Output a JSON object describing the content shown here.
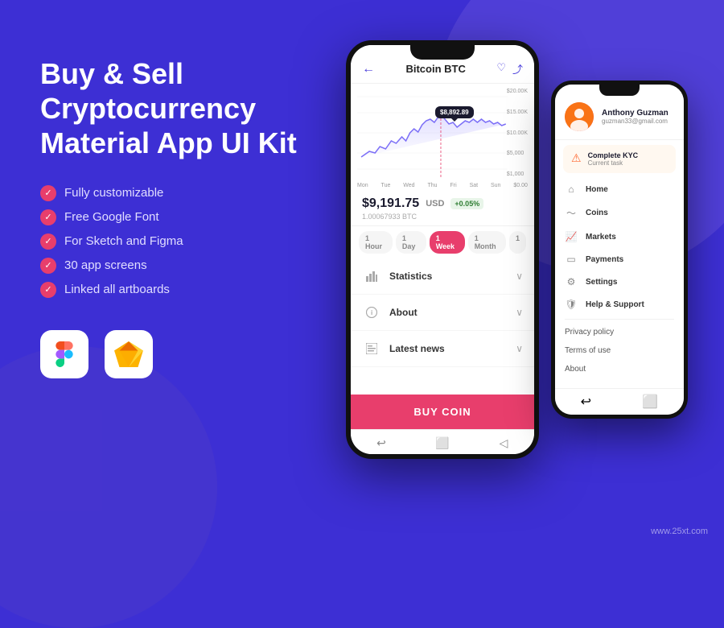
{
  "page": {
    "background": "#3d2fd4",
    "watermark": "www.25xt.com"
  },
  "left": {
    "title": "Buy & Sell\nCryptocurrency\nMaterial App UI Kit",
    "features": [
      "Fully customizable",
      "Free Google Font",
      "For Sketch and Figma",
      "30 app screens",
      "Linked all artboards"
    ],
    "tools": [
      {
        "name": "Figma",
        "icon": "🎨"
      },
      {
        "name": "Sketch",
        "icon": "💎"
      }
    ]
  },
  "main_phone": {
    "header": {
      "back": "←",
      "title": "Bitcoin BTC",
      "icon_heart": "♡",
      "icon_share": "⤴"
    },
    "chart": {
      "y_labels": [
        "$20.00K",
        "$15.00K",
        "$10.00K",
        "$5,000",
        "$1,000"
      ],
      "x_labels": [
        "Mon",
        "Tue",
        "Wed",
        "Thu",
        "Fri",
        "Sat",
        "Sun"
      ],
      "tooltip": "$8,892.89",
      "zero_label": "$0.00"
    },
    "price": {
      "main": "$9,191.75",
      "currency": "USD",
      "badge": "+0.05%",
      "sub": "1.00067933 BTC"
    },
    "time_tabs": [
      "1 Hour",
      "1 Day",
      "1 Week",
      "1 Month",
      "1"
    ],
    "active_tab": "1 Week",
    "accordion": [
      {
        "label": "Statistics",
        "icon": "📊"
      },
      {
        "label": "About",
        "icon": "ℹ️"
      },
      {
        "label": "Latest news",
        "icon": "📰"
      }
    ],
    "buy_button": "BUY COIN"
  },
  "side_phone": {
    "profile": {
      "name": "Anthony Guzman",
      "email": "guzman33@gmail.com"
    },
    "kyc": {
      "title": "Complete KYC",
      "subtitle": "Current task"
    },
    "menu": [
      {
        "label": "Home",
        "icon": "⌂"
      },
      {
        "label": "Coins",
        "icon": "~"
      },
      {
        "label": "Markets",
        "icon": "📊"
      },
      {
        "label": "Payments",
        "icon": "💳"
      },
      {
        "label": "Settings",
        "icon": "⚙"
      },
      {
        "label": "Help & Support",
        "icon": "🛡"
      }
    ],
    "plain_items": [
      "Privacy policy",
      "Terms of use",
      "About"
    ]
  }
}
